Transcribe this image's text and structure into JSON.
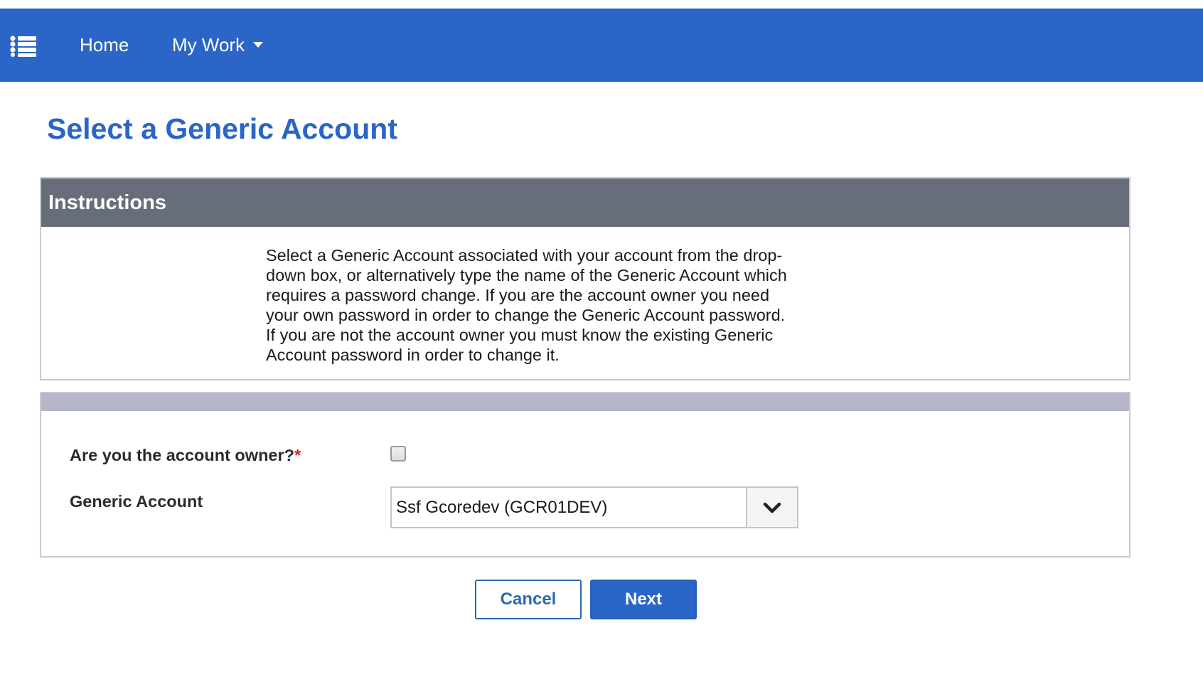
{
  "nav": {
    "menu_icon": "list-menu-icon",
    "home_label": "Home",
    "mywork_label": "My Work",
    "mywork_icon": "caret-down-icon"
  },
  "page": {
    "title": "Select a Generic Account"
  },
  "instructions": {
    "header": "Instructions",
    "text": "Select a Generic Account associated with your account from the drop-down box, or alternatively type the name of the Generic Account which requires a password change. If you are the account owner you need your own password in order to change the Generic Account password. If you are not the account owner you must know the existing Generic Account password in order to change it."
  },
  "form": {
    "owner_label": "Are you the account owner?",
    "required_marker": "*",
    "owner_checked": false,
    "account_label": "Generic Account",
    "account_value": "Ssf Gcoredev (GCR01DEV)",
    "dropdown_icon": "chevron-down-icon"
  },
  "actions": {
    "cancel_label": "Cancel",
    "next_label": "Next"
  },
  "colors": {
    "brand_blue": "#2a65c7",
    "instructions_header": "#676e7a",
    "form_header": "#b5b7c9",
    "required": "#d21e1e"
  }
}
